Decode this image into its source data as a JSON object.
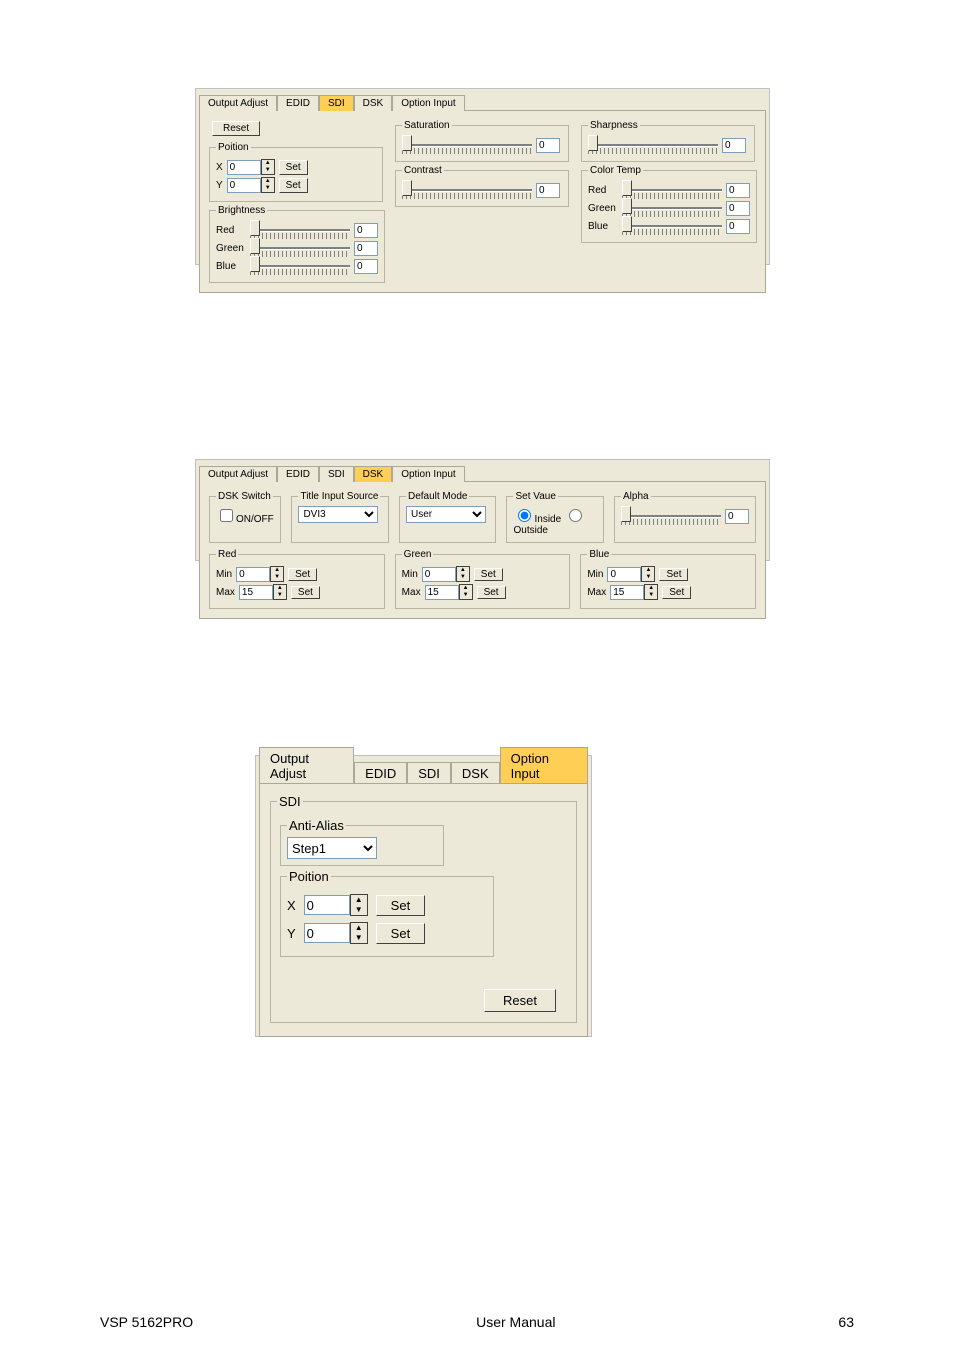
{
  "tabs": {
    "output_adjust": "Output Adjust",
    "edid": "EDID",
    "sdi": "SDI",
    "dsk": "DSK",
    "option_input": "Option Input"
  },
  "sdi_panel": {
    "reset": "Reset",
    "poition": {
      "legend": "Poition",
      "x": "X",
      "y": "Y",
      "xval": "0",
      "yval": "0",
      "set": "Set"
    },
    "brightness": {
      "legend": "Brightness",
      "red": "Red",
      "green": "Green",
      "blue": "Blue",
      "rval": "0",
      "gval": "0",
      "bval": "0"
    },
    "saturation": {
      "legend": "Saturation",
      "val": "0"
    },
    "contrast": {
      "legend": "Contrast",
      "val": "0"
    },
    "sharpness": {
      "legend": "Sharpness",
      "val": "0"
    },
    "colortemp": {
      "legend": "Color Temp",
      "red": "Red",
      "green": "Green",
      "blue": "Blue",
      "rval": "0",
      "gval": "0",
      "bval": "0"
    }
  },
  "dsk_panel": {
    "dsk_switch": {
      "legend": "DSK Switch",
      "onoff": "ON/OFF"
    },
    "title_input": {
      "legend": "Title Input Source",
      "value": "DVI3"
    },
    "default_mode": {
      "legend": "Default Mode",
      "value": "User"
    },
    "set_vaue": {
      "legend": "Set Vaue",
      "inside": "Inside",
      "outside": "Outside"
    },
    "alpha": {
      "legend": "Alpha",
      "val": "0"
    },
    "red": {
      "legend": "Red",
      "min": "Min",
      "max": "Max",
      "minval": "0",
      "maxval": "15",
      "set": "Set"
    },
    "green": {
      "legend": "Green",
      "min": "Min",
      "max": "Max",
      "minval": "0",
      "maxval": "15",
      "set": "Set"
    },
    "blue": {
      "legend": "Blue",
      "min": "Min",
      "max": "Max",
      "minval": "0",
      "maxval": "15",
      "set": "Set"
    }
  },
  "option_panel": {
    "sdi": {
      "legend": "SDI"
    },
    "antialias": {
      "legend": "Anti-Alias",
      "value": "Step1"
    },
    "poition": {
      "legend": "Poition",
      "x": "X",
      "y": "Y",
      "xval": "0",
      "yval": "0",
      "set": "Set"
    },
    "reset": "Reset"
  },
  "footer": {
    "left": "VSP 5162PRO",
    "center": "User Manual",
    "right": "63"
  }
}
